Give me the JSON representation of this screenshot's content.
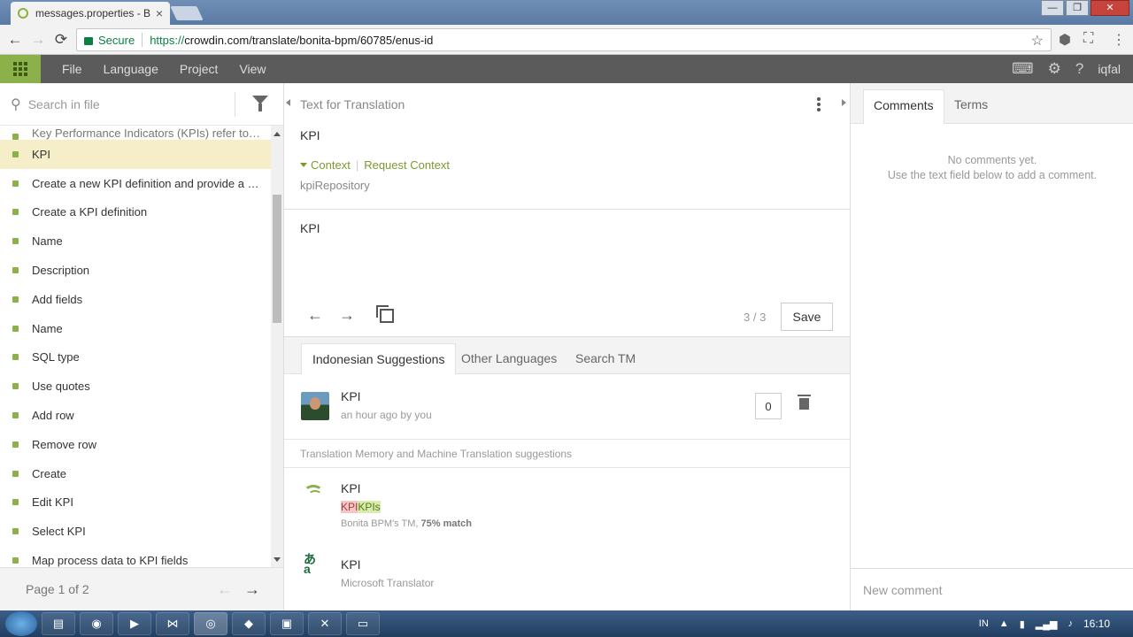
{
  "browser": {
    "tab_title": "messages.properties - Bo",
    "tab_close": "×",
    "window_buttons": [
      "—",
      "❐",
      "✕"
    ],
    "secure_label": "Secure",
    "url_proto": "https://",
    "url_host": "crowdin.com",
    "url_path": "/translate/bonita-bpm/60785/enus-id"
  },
  "appbar": {
    "menus": [
      "File",
      "Language",
      "Project",
      "View"
    ],
    "user": "iqfal"
  },
  "left": {
    "search_placeholder": "Search in file",
    "cut_item": "Key Performance Indicators (KPIs) refer to th...",
    "items": [
      {
        "label": "KPI",
        "selected": true
      },
      {
        "label": "Create a new KPI definition and provide a d..."
      },
      {
        "label": "Create a KPI definition"
      },
      {
        "label": "Name"
      },
      {
        "label": "Description"
      },
      {
        "label": "Add fields"
      },
      {
        "label": "Name"
      },
      {
        "label": "SQL type"
      },
      {
        "label": "Use quotes"
      },
      {
        "label": "Add row"
      },
      {
        "label": "Remove row"
      },
      {
        "label": "Create"
      },
      {
        "label": "Edit KPI"
      },
      {
        "label": "Select KPI"
      },
      {
        "label": "Map process data to KPI fields"
      }
    ],
    "page": "Page 1 of 2",
    "prev_arrow": "←",
    "next_arrow": "→"
  },
  "center": {
    "header": "Text for Translation",
    "source_text": "KPI",
    "context_label": "Context",
    "request_context": "Request Context",
    "key": "kpiRepository",
    "translation": "KPI",
    "counter": "3 / 3",
    "save": "Save",
    "tabs": [
      "Indonesian Suggestions",
      "Other Languages",
      "Search TM"
    ],
    "suggestion": {
      "text": "KPI",
      "meta": "an hour ago by you",
      "votes": "0"
    },
    "tm_header": "Translation Memory and Machine Translation suggestions",
    "tm": [
      {
        "text": "KPI",
        "hl1": "KPI",
        "hl2": "KPIs",
        "meta": "Bonita BPM's TM, ",
        "match": "75% match"
      },
      {
        "text": "KPI",
        "meta": "Microsoft Translator"
      }
    ]
  },
  "right": {
    "tabs": [
      "Comments",
      "Terms"
    ],
    "no_comments": "No comments yet.",
    "hint": "Use the text field below to add a comment.",
    "new_comment": "New comment"
  },
  "taskbar": {
    "lang": "IN",
    "time": "16:10"
  }
}
